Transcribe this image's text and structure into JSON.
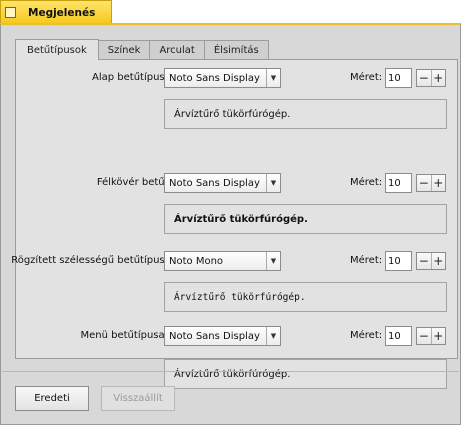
{
  "window": {
    "title": "Megjelenés"
  },
  "tabs": [
    "Betűtípusok",
    "Színek",
    "Arculat",
    "Élsimítás"
  ],
  "fonts": [
    {
      "label": "Alap betűtípus:",
      "family": "Noto Sans Display",
      "size_label": "Méret:",
      "size": "10",
      "preview": "Árvíztűrő tükörfúrógép."
    },
    {
      "label": "Félkövér betű:",
      "family": "Noto Sans Display",
      "size_label": "Méret:",
      "size": "10",
      "preview": "Árvíztűrő tükörfúrógép."
    },
    {
      "label": "Rögzített szélességű betűtípus:",
      "family": "Noto Mono",
      "size_label": "Méret:",
      "size": "10",
      "preview": "Árvíztűrő tükörfúrógép."
    },
    {
      "label": "Menü betűtípusa:",
      "family": "Noto Sans Display",
      "size_label": "Méret:",
      "size": "10",
      "preview": "Árvíztűrő tükörfúrógép."
    }
  ],
  "stepper": {
    "minus": "−",
    "plus": "+"
  },
  "buttons": {
    "defaults": "Eredeti",
    "revert": "Visszaállít"
  },
  "colors": {
    "title_tab": "#f5c81a",
    "window_bg": "#d8d8d8",
    "panel_bg": "#e2e2e2"
  }
}
